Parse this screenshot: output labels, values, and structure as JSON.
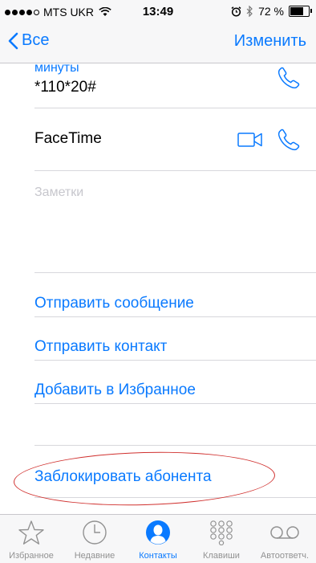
{
  "status_bar": {
    "carrier": "MTS UKR",
    "time": "13:49",
    "battery": "72 %",
    "battery_level": 0.72,
    "signal_bars_filled": 4,
    "signal_bars_total": 5
  },
  "nav": {
    "back_label": "Все",
    "edit_label": "Изменить"
  },
  "fields": {
    "minutes_label": "минуты",
    "minutes_value": "*110*20#",
    "facetime_label": "FaceTime",
    "notes_placeholder": "Заметки"
  },
  "actions": {
    "send_message": "Отправить сообщение",
    "share_contact": "Отправить контакт",
    "add_favorite": "Добавить в Избранное",
    "block_caller": "Заблокировать абонента"
  },
  "tab_bar": {
    "tabs": [
      {
        "label": "Избранное",
        "icon": "star-icon"
      },
      {
        "label": "Недавние",
        "icon": "clock-icon"
      },
      {
        "label": "Контакты",
        "icon": "contacts-icon"
      },
      {
        "label": "Клавиши",
        "icon": "keypad-icon"
      },
      {
        "label": "Автоответч.",
        "icon": "voicemail-icon"
      }
    ],
    "active_index": 2
  },
  "colors": {
    "accent": "#0a7aff",
    "annotation": "#d0302e"
  }
}
